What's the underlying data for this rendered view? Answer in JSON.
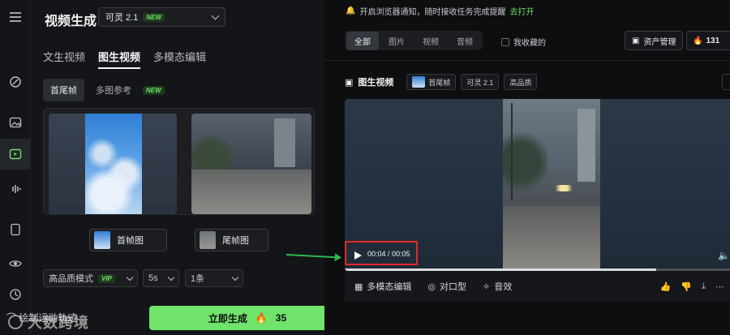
{
  "app": {
    "title": "视频生成",
    "model": {
      "name": "可灵 2.1",
      "badge": "NEW"
    }
  },
  "left_panel": {
    "tabs": [
      {
        "label": "文生视频",
        "active": false
      },
      {
        "label": "图生视频",
        "active": true
      },
      {
        "label": "多模态编辑",
        "active": false
      }
    ],
    "sub_tabs": [
      {
        "label": "首尾帧",
        "active": true
      },
      {
        "label": "多图参考",
        "badge": "NEW",
        "active": false
      }
    ],
    "frames": {
      "first_label": "首帧图",
      "last_label": "尾帧图",
      "swap_symbol": "⇆"
    },
    "options": {
      "quality": {
        "label": "高品质模式",
        "badge": "VIP"
      },
      "duration": "5s",
      "count": "1条"
    },
    "bottom": {
      "left_text": "⌒ 绘制运动轨迹",
      "generate": {
        "label": "立即生成",
        "cost": "35"
      }
    }
  },
  "right_panel": {
    "notice": {
      "text": "开启浏览器通知，随时接收任务完成提醒",
      "link": "去打开"
    },
    "filters": [
      {
        "label": "全部",
        "active": true
      },
      {
        "label": "图片",
        "active": false
      },
      {
        "label": "视频",
        "active": false
      },
      {
        "label": "音频",
        "active": false
      }
    ],
    "favorites_label": "我收藏的",
    "asset_button": "资产管理",
    "credits": "131",
    "meta": {
      "type_label": "图生视频",
      "chips": [
        "首尾帧",
        "可灵 2.1",
        "高品质"
      ]
    },
    "player": {
      "time": "00:04 / 00:05",
      "progress": 0.8
    },
    "actions": [
      {
        "icon": "multimodal-edit-icon",
        "label": "多模态编辑"
      },
      {
        "icon": "lip-sync-icon",
        "label": "对口型"
      },
      {
        "icon": "sound-effect-icon",
        "label": "音效"
      }
    ]
  },
  "watermark": "大数跨境",
  "colors": {
    "accent": "#6fe36a",
    "highlight_border": "#e02b2b",
    "arrow": "#2fb84f"
  }
}
